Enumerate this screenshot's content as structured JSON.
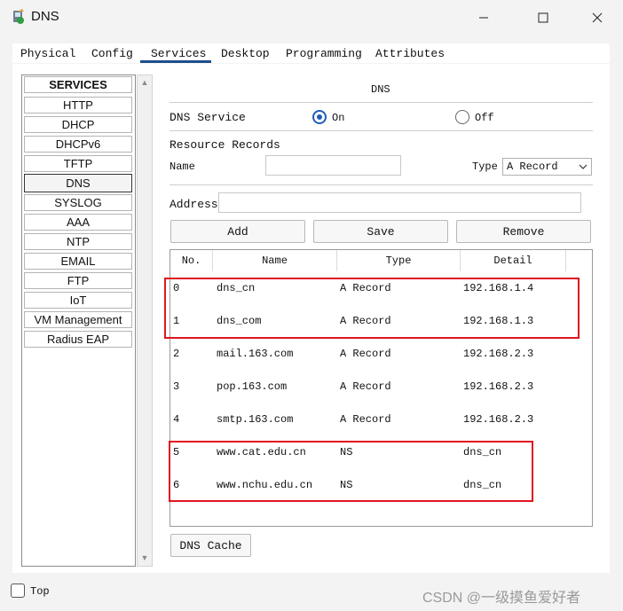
{
  "window": {
    "title": "DNS",
    "minimize_icon": "minimize-icon",
    "maximize_icon": "maximize-icon",
    "close_icon": "close-icon"
  },
  "tabs": [
    {
      "label": "Physical"
    },
    {
      "label": "Config"
    },
    {
      "label": "Services",
      "active": true
    },
    {
      "label": "Desktop"
    },
    {
      "label": "Programming"
    },
    {
      "label": "Attributes"
    }
  ],
  "sidebar": {
    "header": "SERVICES",
    "items": [
      {
        "label": "HTTP"
      },
      {
        "label": "DHCP"
      },
      {
        "label": "DHCPv6"
      },
      {
        "label": "TFTP"
      },
      {
        "label": "DNS",
        "selected": true
      },
      {
        "label": "SYSLOG"
      },
      {
        "label": "AAA"
      },
      {
        "label": "NTP"
      },
      {
        "label": "EMAIL"
      },
      {
        "label": "FTP"
      },
      {
        "label": "IoT"
      },
      {
        "label": "VM Management"
      },
      {
        "label": "Radius EAP"
      }
    ]
  },
  "dns": {
    "section_title": "DNS",
    "service_label": "DNS Service",
    "on_label": "On",
    "off_label": "Off",
    "service_state": "On",
    "records_label": "Resource Records",
    "name_label": "Name",
    "name_value": "",
    "type_label": "Type",
    "type_value": "A Record",
    "address_label": "Address",
    "address_value": "",
    "buttons": {
      "add": "Add",
      "save": "Save",
      "remove": "Remove"
    },
    "cache_button": "DNS Cache"
  },
  "table": {
    "headers": [
      "No.",
      "Name",
      "Type",
      "Detail"
    ],
    "rows": [
      {
        "no": "0",
        "name": "dns_cn",
        "type": "A Record",
        "detail": "192.168.1.4"
      },
      {
        "no": "1",
        "name": "dns_com",
        "type": "A Record",
        "detail": "192.168.1.3"
      },
      {
        "no": "2",
        "name": "mail.163.com",
        "type": "A Record",
        "detail": "192.168.2.3"
      },
      {
        "no": "3",
        "name": "pop.163.com",
        "type": "A Record",
        "detail": "192.168.2.3"
      },
      {
        "no": "4",
        "name": "smtp.163.com",
        "type": "A Record",
        "detail": "192.168.2.3"
      },
      {
        "no": "5",
        "name": "www.cat.edu.cn",
        "type": "NS",
        "detail": "dns_cn"
      },
      {
        "no": "6",
        "name": "www.nchu.edu.cn",
        "type": "NS",
        "detail": "dns_cn"
      }
    ]
  },
  "footer": {
    "top_label": "Top",
    "top_checked": false,
    "watermark": "CSDN @一级摸鱼爱好者"
  },
  "colors": {
    "highlight": "#e0151e",
    "radio_accent": "#1f5fb8",
    "tab_underline": "#1f4e8c"
  }
}
